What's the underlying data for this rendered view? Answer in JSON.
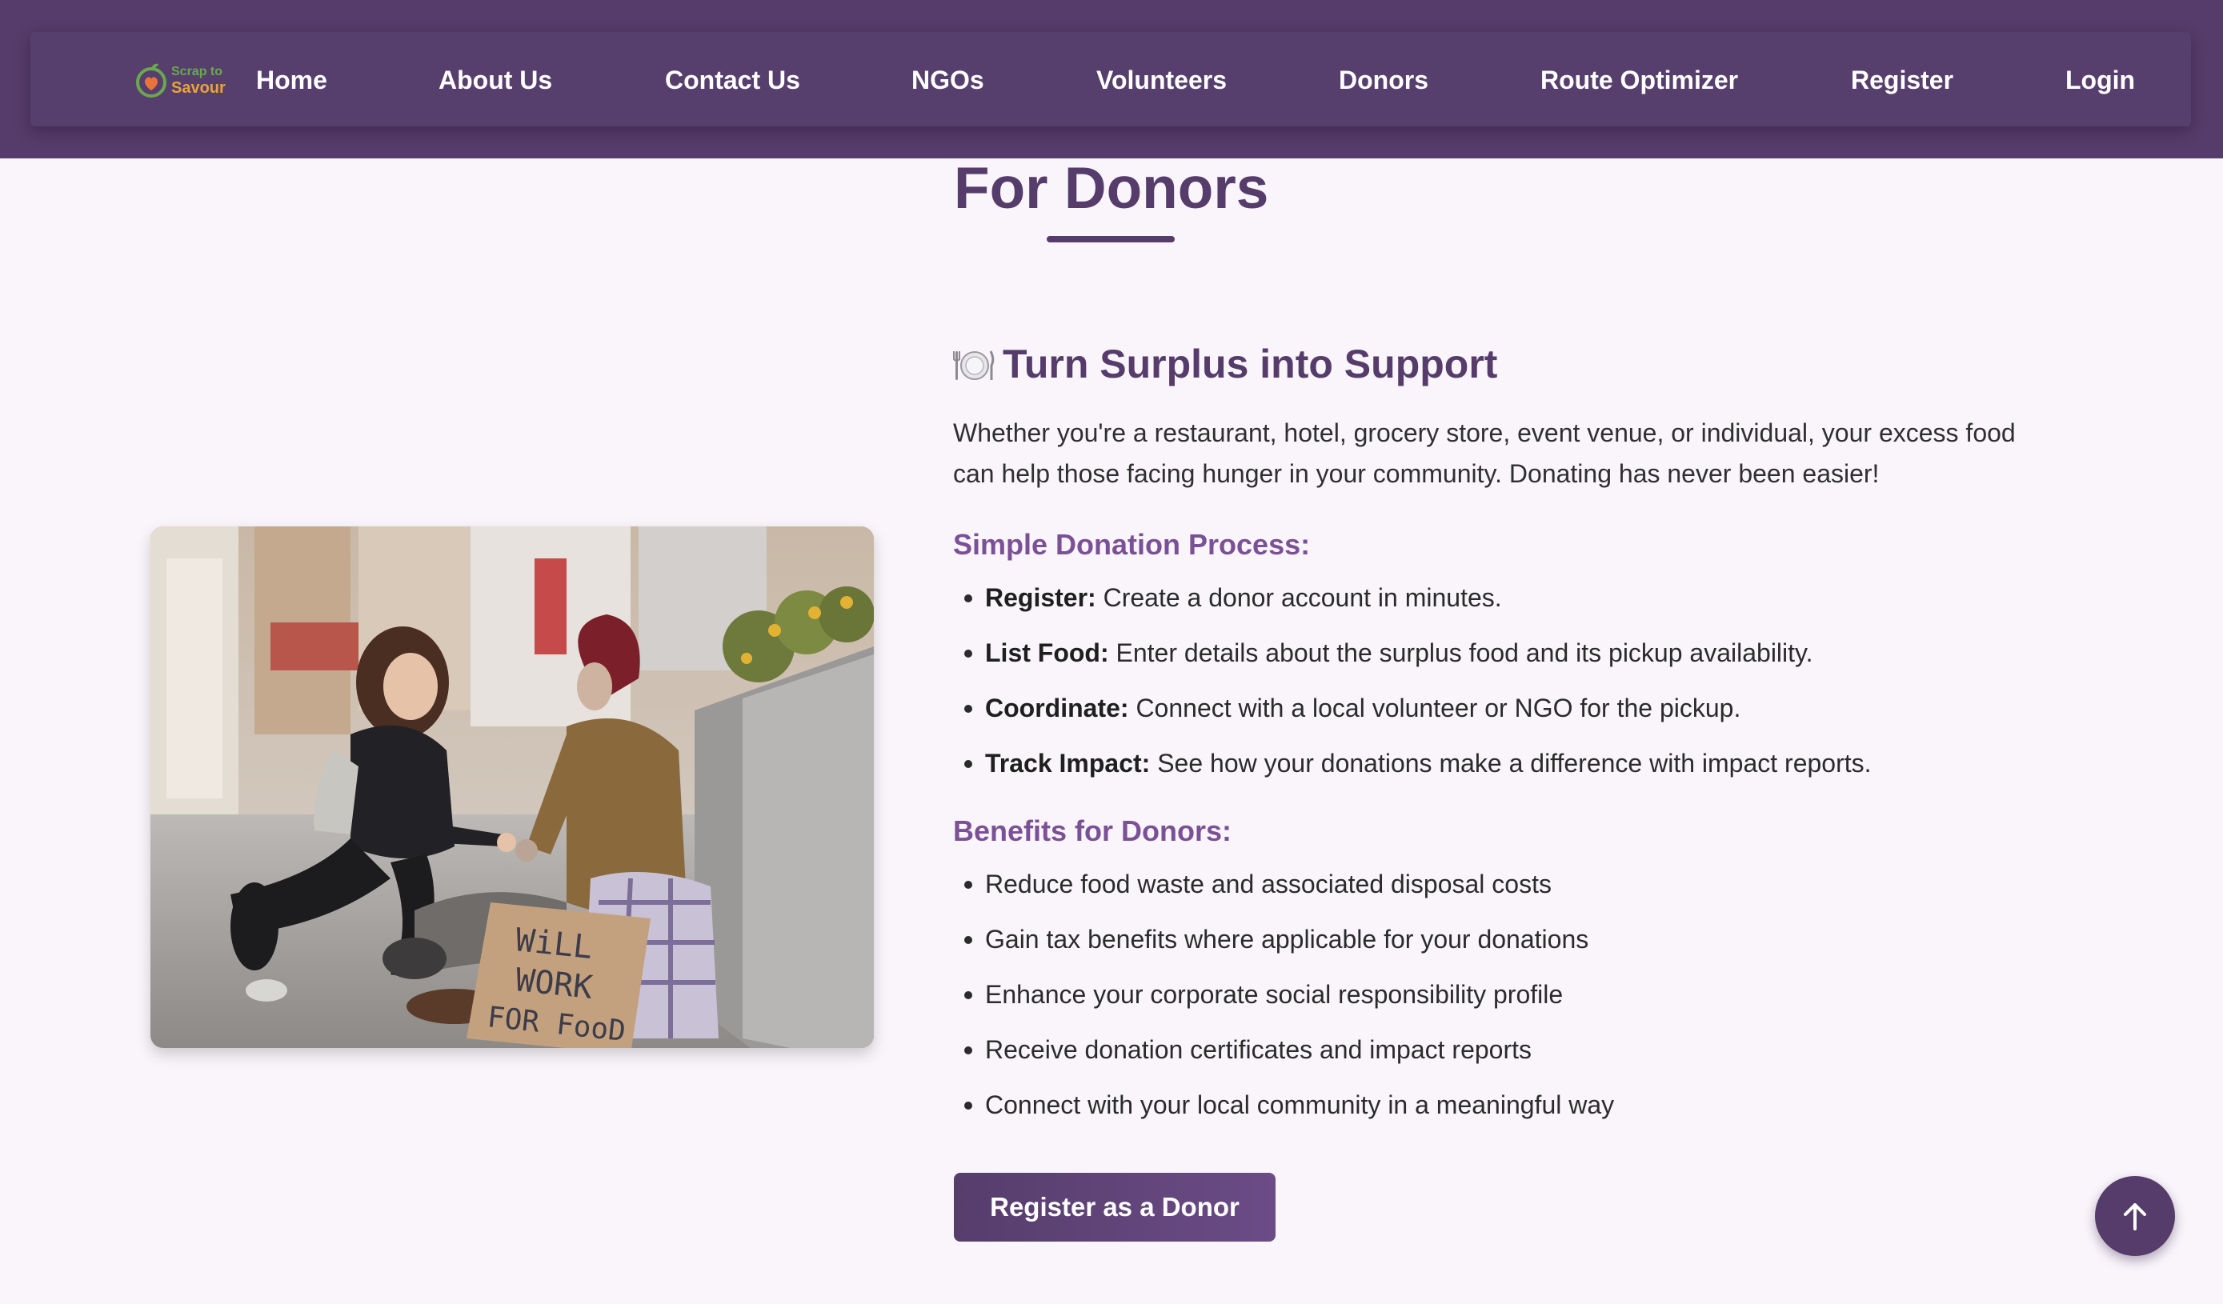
{
  "brand": {
    "line1": "Scrap to",
    "line2": "Savour"
  },
  "nav": {
    "home": "Home",
    "about": "About Us",
    "contact": "Contact Us",
    "ngos": "NGOs",
    "volunteers": "Volunteers",
    "donors": "Donors",
    "route": "Route Optimizer",
    "register": "Register",
    "login": "Login"
  },
  "page": {
    "title": "For Donors",
    "heading": "Turn Surplus into Support",
    "heading_icon": "plate-cutlery-icon",
    "intro": "Whether you're a restaurant, hotel, grocery store, event venue, or individual, your excess food can help those facing hunger in your community. Donating has never been easier!"
  },
  "process": {
    "title": "Simple Donation Process:",
    "items": [
      {
        "term": "Register:",
        "text": " Create a donor account in minutes."
      },
      {
        "term": "List Food:",
        "text": " Enter details about the surplus food and its pickup availability."
      },
      {
        "term": "Coordinate:",
        "text": " Connect with a local volunteer or NGO for the pickup."
      },
      {
        "term": "Track Impact:",
        "text": " See how your donations make a difference with impact reports."
      }
    ]
  },
  "benefits": {
    "title": "Benefits for Donors:",
    "items": [
      "Reduce food waste and associated disposal costs",
      "Gain tax benefits where applicable for your donations",
      "Enhance your corporate social responsibility profile",
      "Receive donation certificates and impact reports",
      "Connect with your local community in a meaningful way"
    ]
  },
  "photo": {
    "sign_line1": "WiLL",
    "sign_line2": "WORK",
    "sign_line3": "FOR FooD"
  },
  "cta": {
    "label": "Register as a Donor"
  },
  "colors": {
    "primary": "#553c6a",
    "accent": "#7b5196",
    "background": "#f9f5fb",
    "logo_green": "#6aa84f",
    "logo_orange": "#e8a33a"
  },
  "icons": {
    "scroll_top": "arrow-up-icon"
  }
}
